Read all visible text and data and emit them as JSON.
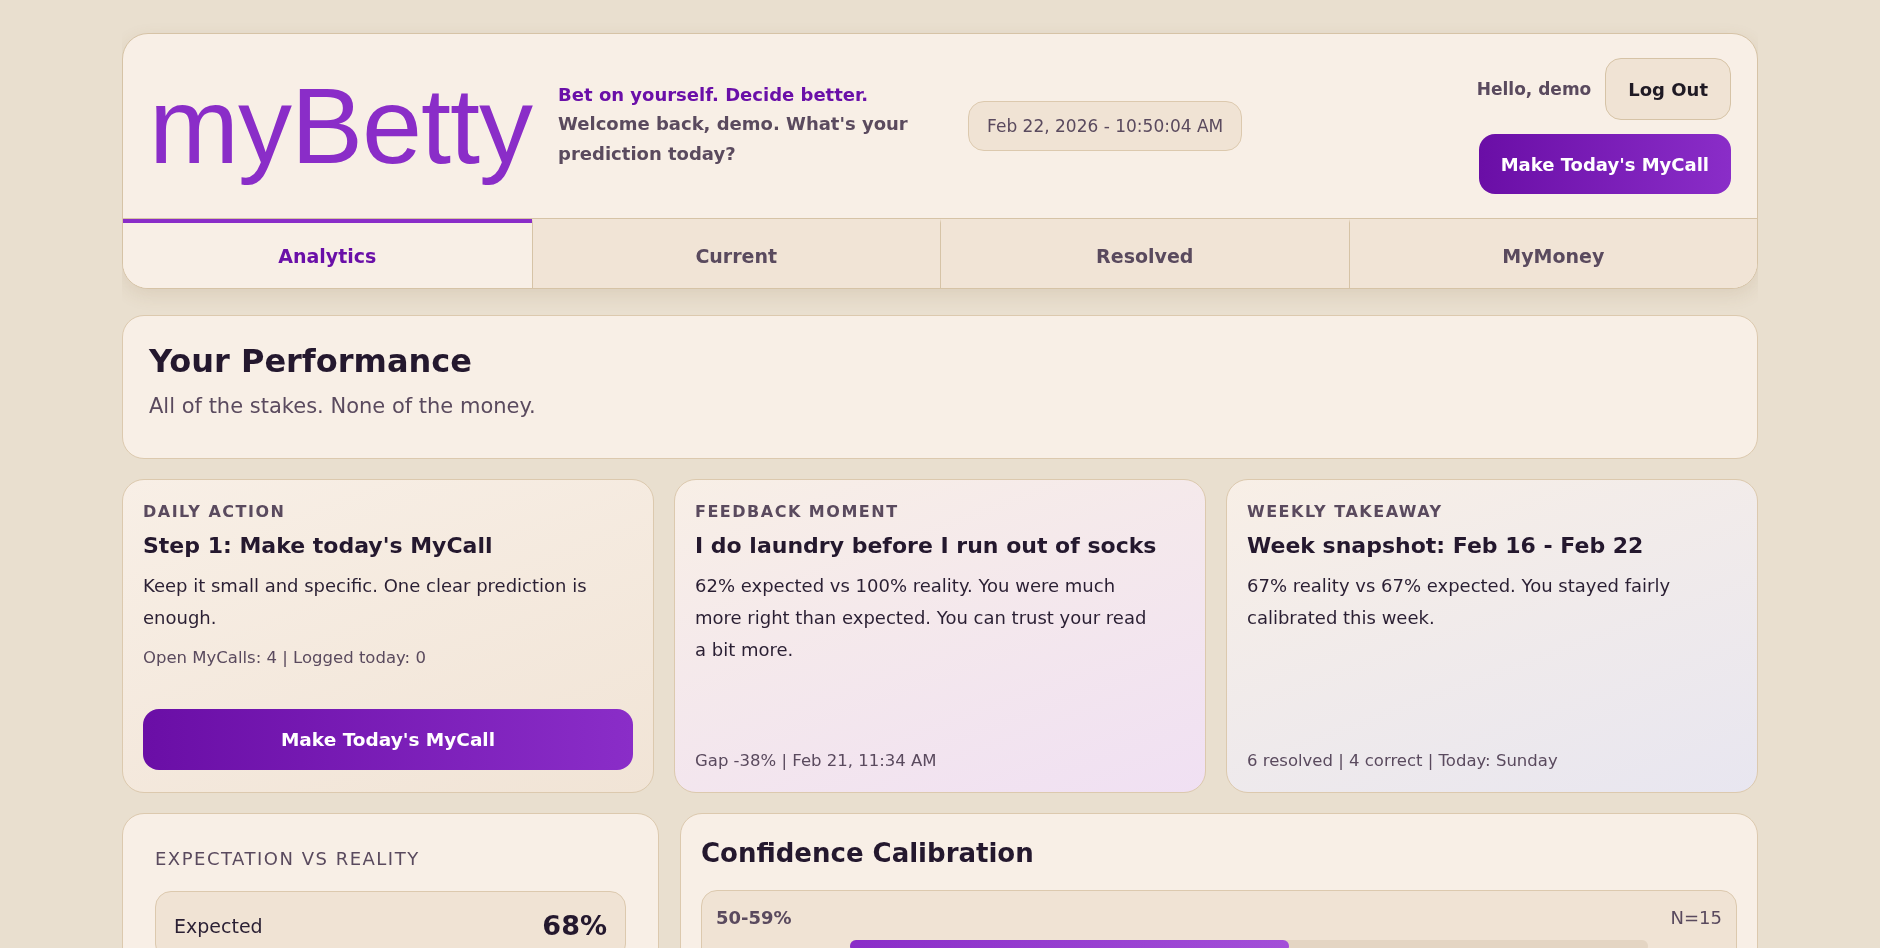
{
  "header": {
    "logo": "myBetty",
    "tagline": "Bet on yourself. Decide better.",
    "welcome": "Welcome back, demo. What's your prediction today?",
    "datetime": "Feb 22, 2026 - 10:50:04 AM",
    "greeting": "Hello, demo",
    "logout": "Log Out",
    "cta": "Make Today's MyCall"
  },
  "tabs": [
    {
      "label": "Analytics",
      "selected": true
    },
    {
      "label": "Current",
      "selected": false
    },
    {
      "label": "Resolved",
      "selected": false
    },
    {
      "label": "MyMoney",
      "selected": false
    }
  ],
  "performance": {
    "title": "Your Performance",
    "subtitle": "All of the stakes. None of the money."
  },
  "cards": [
    {
      "eyebrow": "DAILY ACTION",
      "title": "Step 1: Make today's MyCall",
      "body": "Keep it small and specific. One clear prediction is enough.",
      "meta": "Open MyCalls: 4 | Logged today: 0",
      "button": "Make Today's MyCall"
    },
    {
      "eyebrow": "FEEDBACK MOMENT",
      "title": "I do laundry before I run out of socks",
      "body": "62% expected vs 100% reality. You were much more right than expected. You can trust your read a bit more.",
      "meta": "Gap -38% | Feb 21, 11:34 AM"
    },
    {
      "eyebrow": "WEEKLY TAKEAWAY",
      "title": "Week snapshot: Feb 16 - Feb 22",
      "body": "67% reality vs 67% expected. You stayed fairly calibrated this week.",
      "meta": "6 resolved | 4 correct | Today: Sunday"
    }
  ],
  "expectation": {
    "title": "EXPECTATION VS REALITY",
    "rows": [
      {
        "label": "Expected",
        "value": "68%"
      }
    ]
  },
  "calibration": {
    "title": "Confidence Calibration",
    "buckets": [
      {
        "range": "50-59%",
        "n": "N=15",
        "bars": [
          {
            "level": 0.55
          }
        ]
      }
    ]
  }
}
